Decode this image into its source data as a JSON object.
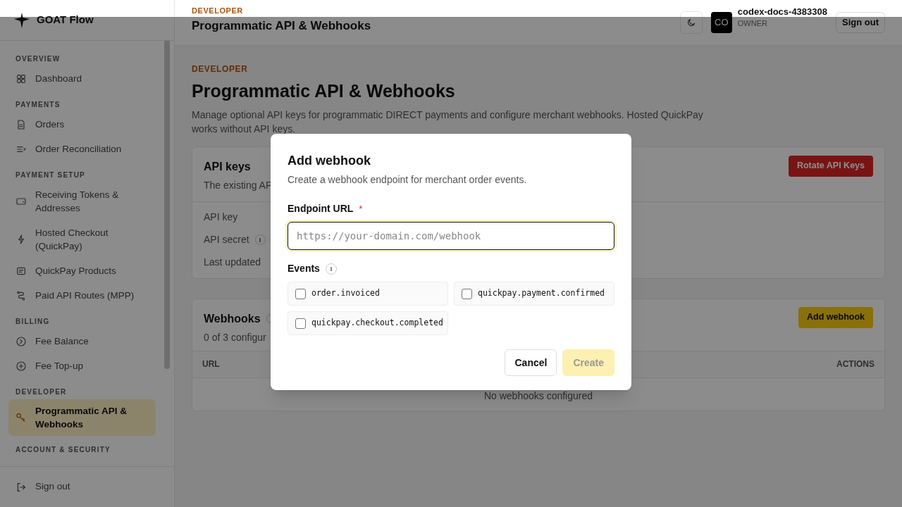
{
  "brand": {
    "name": "GOAT Flow"
  },
  "sidebar": {
    "sections": [
      {
        "title": "OVERVIEW",
        "items": [
          {
            "label": "Dashboard",
            "selected": false
          }
        ]
      },
      {
        "title": "PAYMENTS",
        "items": [
          {
            "label": "Orders",
            "selected": false
          },
          {
            "label": "Order Reconciliation",
            "selected": false
          }
        ]
      },
      {
        "title": "PAYMENT SETUP",
        "items": [
          {
            "label": "Receiving Tokens & Addresses",
            "selected": false
          },
          {
            "label": "Hosted Checkout (QuickPay)",
            "selected": false
          },
          {
            "label": "QuickPay Products",
            "selected": false
          },
          {
            "label": "Paid API Routes (MPP)",
            "selected": false
          }
        ]
      },
      {
        "title": "BILLING",
        "items": [
          {
            "label": "Fee Balance",
            "selected": false
          },
          {
            "label": "Fee Top-up",
            "selected": false
          }
        ]
      },
      {
        "title": "DEVELOPER",
        "items": [
          {
            "label": "Programmatic API & Webhooks",
            "selected": true
          }
        ]
      },
      {
        "title": "ACCOUNT & SECURITY"
      }
    ],
    "footer": {
      "label": "Sign out"
    }
  },
  "header": {
    "eyebrow": "DEVELOPER",
    "title": "Programmatic API & Webhooks",
    "avatar": "CO",
    "user": "codex-docs-4383308",
    "role": "OWNER",
    "sign_out": "Sign out"
  },
  "page": {
    "eyebrow": "DEVELOPER",
    "title": "Programmatic API & Webhooks",
    "description": "Manage optional API keys for programmatic DIRECT payments and configure merchant webhooks. Hosted QuickPay works without API keys."
  },
  "api_keys": {
    "title": "API keys",
    "description": "The existing AP",
    "button": "Rotate API Keys",
    "rows": [
      {
        "label": "API key",
        "info": false
      },
      {
        "label": "API secret",
        "info": true
      },
      {
        "label": "Last updated",
        "info": false
      }
    ]
  },
  "webhooks": {
    "title": "Webhooks",
    "description": "0 of 3 configur",
    "button": "Add webhook",
    "columns": [
      "URL",
      "ACTIONS"
    ],
    "empty": "No webhooks configured"
  },
  "modal": {
    "title": "Add webhook",
    "description": "Create a webhook endpoint for merchant order events.",
    "field": {
      "label": "Endpoint URL",
      "required": "*",
      "placeholder": "https://your-domain.com/webhook",
      "focused": true
    },
    "events_label": "Events",
    "events": [
      {
        "label": "order.invoiced",
        "checked": false
      },
      {
        "label": "quickpay.payment.confirmed",
        "checked": false
      },
      {
        "label": "quickpay.checkout.completed",
        "checked": false
      }
    ],
    "cancel": "Cancel",
    "create": {
      "label": "Create",
      "disabled": true
    }
  }
}
